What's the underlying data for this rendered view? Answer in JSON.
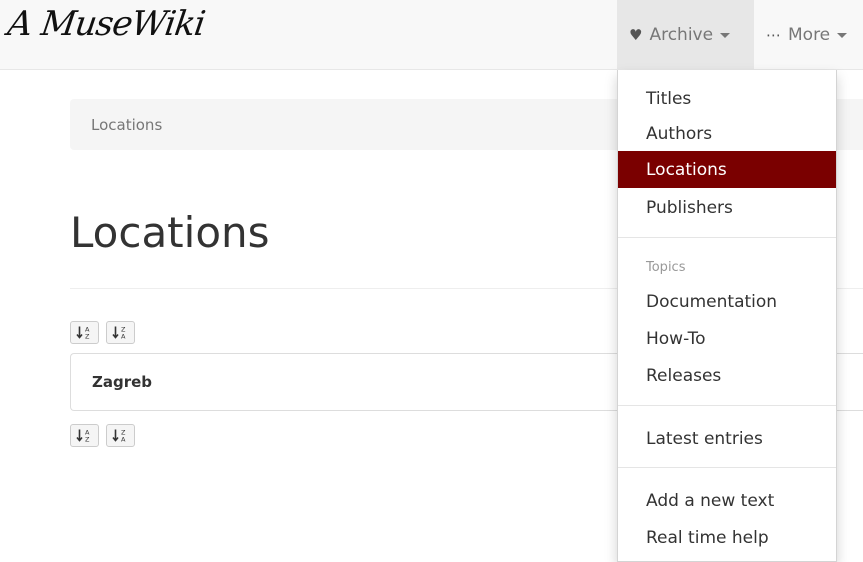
{
  "brand": {
    "logo_text": "A MuseWiki"
  },
  "nav": {
    "archive_label": "Archive",
    "archive_icon": "heart-icon",
    "more_label": "More",
    "more_icon": "ellipsis-icon"
  },
  "breadcrumb": {
    "current": "Locations"
  },
  "page": {
    "title": "Locations"
  },
  "sort": {
    "asc_icon": "sort-alpha-asc-icon",
    "desc_icon": "sort-alpha-desc-icon"
  },
  "locations": [
    {
      "name": "Zagreb"
    }
  ],
  "dropdown": {
    "items_primary": [
      "Titles",
      "Authors",
      "Locations",
      "Publishers"
    ],
    "active_item": "Locations",
    "topics_header": "Topics",
    "items_topics": [
      "Documentation",
      "How-To",
      "Releases"
    ],
    "latest": "Latest entries",
    "items_help": [
      "Add a new text",
      "Real time help"
    ]
  },
  "colors": {
    "active_bg": "#7a0000",
    "navbar_bg": "#f8f8f8",
    "breadcrumb_bg": "#f5f5f5"
  }
}
